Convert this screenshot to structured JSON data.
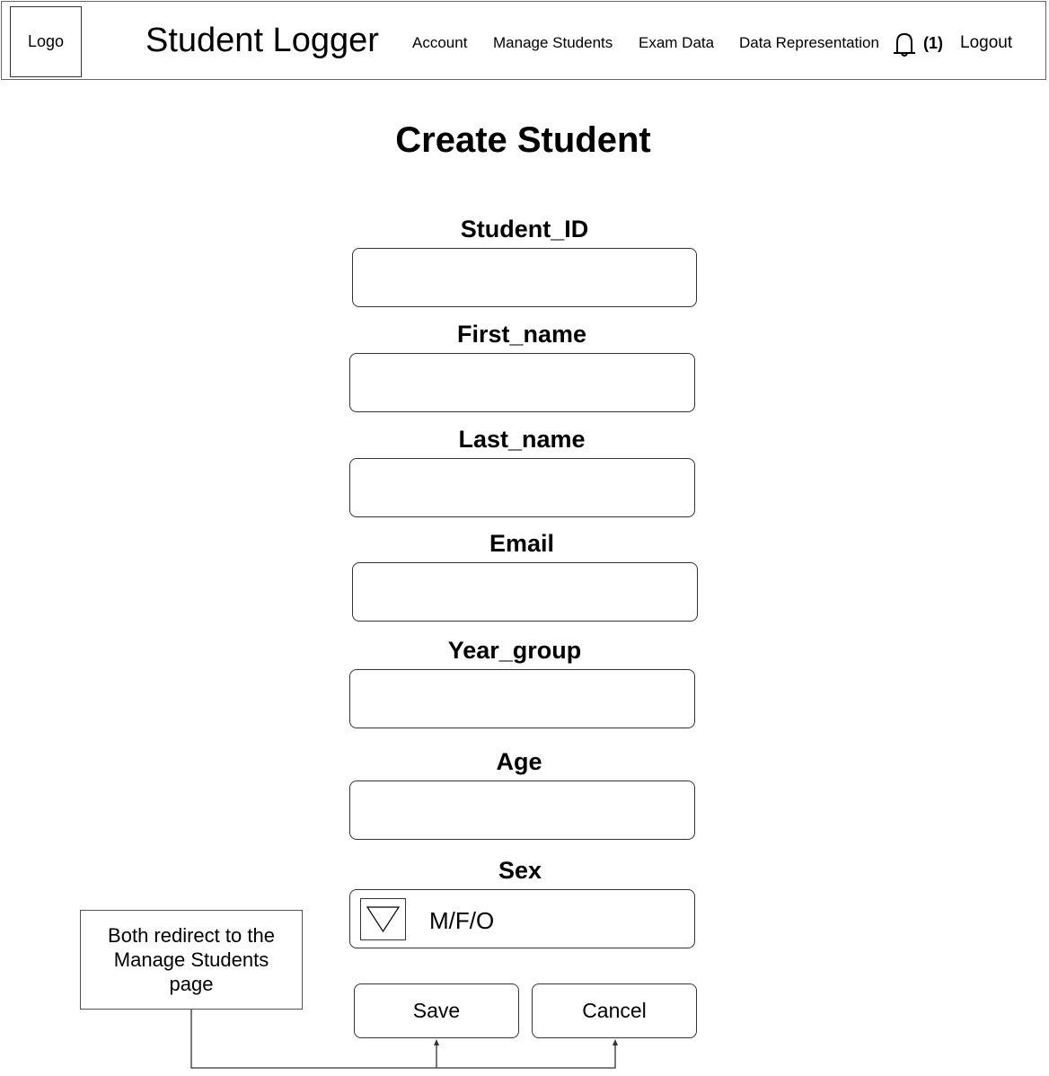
{
  "header": {
    "logo": "Logo",
    "app_title": "Student Logger",
    "nav": {
      "account": "Account",
      "manage_students": "Manage Students",
      "exam_data": "Exam Data",
      "data_representation": "Data Representation"
    },
    "notification_icon": "bell-icon",
    "notification_count": "(1)",
    "logout": "Logout"
  },
  "main": {
    "title": "Create Student",
    "fields": {
      "student_id": {
        "label": "Student_ID",
        "value": ""
      },
      "first_name": {
        "label": "First_name",
        "value": ""
      },
      "last_name": {
        "label": "Last_name",
        "value": ""
      },
      "email": {
        "label": "Email",
        "value": ""
      },
      "year_group": {
        "label": "Year_group",
        "value": ""
      },
      "age": {
        "label": "Age",
        "value": ""
      },
      "sex": {
        "label": "Sex",
        "value": "M/F/O",
        "dropdown_icon": "triangle-down-icon"
      }
    },
    "buttons": {
      "save": "Save",
      "cancel": "Cancel"
    }
  },
  "annotation": {
    "note": "Both redirect to the Manage Students page"
  }
}
